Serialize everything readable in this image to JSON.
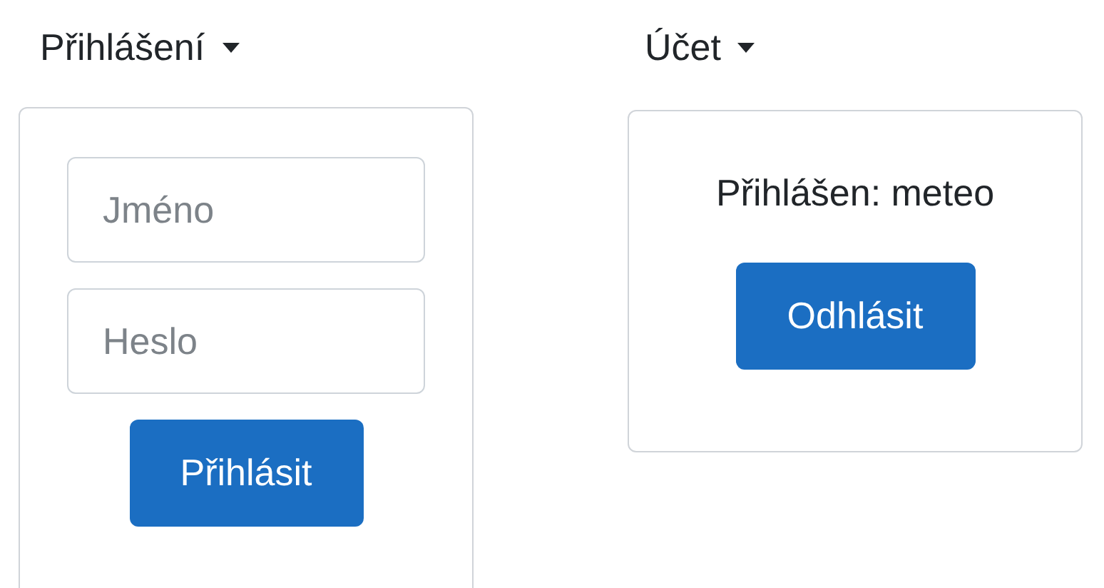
{
  "login_menu": {
    "toggle": "Přihlášení",
    "expanded": true,
    "username": {
      "placeholder": "Jméno"
    },
    "password": {
      "placeholder": "Heslo"
    },
    "button": "Přihlásit"
  },
  "account_menu": {
    "toggle": "Účet",
    "expanded": true,
    "status": "Přihlášen: meteo",
    "button": "Odhlásit"
  }
}
